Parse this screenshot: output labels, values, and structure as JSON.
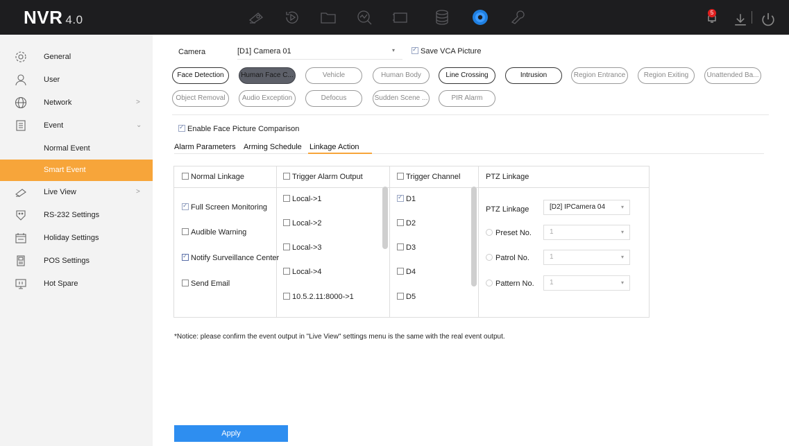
{
  "app": {
    "logo": "NVR",
    "version": "4.0",
    "notification_count": "5"
  },
  "topbar_icons": [
    "live-view-icon",
    "playback-icon",
    "file-icon",
    "smart-analysis-icon",
    "camera-icon",
    "storage-icon",
    "configuration-icon",
    "maintenance-icon"
  ],
  "sidebar": {
    "items": [
      {
        "label": "General",
        "icon": "general-icon"
      },
      {
        "label": "User",
        "icon": "user-icon"
      },
      {
        "label": "Network",
        "icon": "network-icon",
        "chevron": ">"
      },
      {
        "label": "Event",
        "icon": "event-icon",
        "chevron": "⌄"
      },
      {
        "label": "Normal Event"
      },
      {
        "label": "Smart Event"
      },
      {
        "label": "Live View",
        "icon": "live-view-icon",
        "chevron": ">"
      },
      {
        "label": "RS-232 Settings",
        "icon": "rs232-icon"
      },
      {
        "label": "Holiday Settings",
        "icon": "holiday-icon"
      },
      {
        "label": "POS Settings",
        "icon": "pos-icon"
      },
      {
        "label": "Hot Spare",
        "icon": "hot-spare-icon"
      }
    ]
  },
  "camera": {
    "label": "Camera",
    "value": "[D1] Camera 01",
    "save_vca": "Save VCA Picture"
  },
  "event_types": [
    "Face Detection",
    "Human Face C...",
    "Vehicle",
    "Human Body",
    "Line Crossing",
    "Intrusion",
    "Region Entrance",
    "Region Exiting",
    "Unattended Ba...",
    "Object Removal",
    "Audio Exception",
    "Defocus",
    "Sudden Scene ...",
    "PIR Alarm"
  ],
  "enable_face_comparison": "Enable Face Picture Comparison",
  "tabs": [
    "Alarm Parameters",
    "Arming Schedule",
    "Linkage Action"
  ],
  "linkage": {
    "normal_header": "Normal Linkage",
    "normal_items": [
      "Full Screen Monitoring",
      "Audible Warning",
      "Notify Surveillance Center",
      "Send Email"
    ],
    "alarm_header": "Trigger Alarm Output",
    "alarm_items": [
      "Local->1",
      "Local->2",
      "Local->3",
      "Local->4",
      "10.5.2.11:8000->1"
    ],
    "channel_header": "Trigger Channel",
    "channel_items": [
      "D1",
      "D2",
      "D3",
      "D4",
      "D5"
    ],
    "ptz_header": "PTZ Linkage",
    "ptz_linkage_label": "PTZ Linkage",
    "ptz_linkage_value": "[D2] IPCamera 04",
    "preset_label": "Preset No.",
    "preset_value": "1",
    "patrol_label": "Patrol No.",
    "patrol_value": "1",
    "pattern_label": "Pattern No.",
    "pattern_value": "1"
  },
  "notice": "*Notice: please confirm the event output in \"Live View\" settings menu is the same with the real event output.",
  "apply_label": "Apply",
  "colors": {
    "accent": "#f7a53a",
    "primary_button": "#2e8ef0",
    "selected_pill": "#5d6069",
    "topbar": "#1d1d1f"
  }
}
